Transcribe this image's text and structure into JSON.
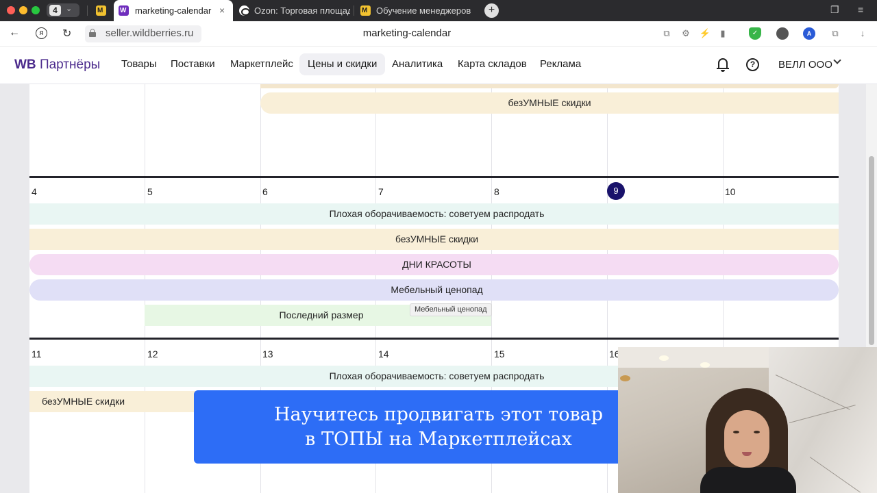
{
  "browser": {
    "tab_count": "4",
    "tabs": [
      {
        "label": ""
      },
      {
        "label": "marketing-calendar"
      },
      {
        "label": "Ozon: Торговая площадка"
      },
      {
        "label": "Обучение менеджеров"
      }
    ],
    "url": "seller.wildberries.ru",
    "page_title": "marketing-calendar",
    "new_tab_symbol": "+",
    "close_symbol": "×"
  },
  "header": {
    "brand_bold": "WB",
    "brand_rest": "Партнёры",
    "menu": [
      "Товары",
      "Поставки",
      "Маркетплейс",
      "Цены и скидки",
      "Аналитика",
      "Карта складов",
      "Реклама"
    ],
    "active_menu": "Цены и скидки",
    "help_symbol": "?",
    "account_name": "ВЕЛЛ ООО"
  },
  "calendar": {
    "prev_week": {
      "events": [
        "безУМНЫЕ скидки"
      ]
    },
    "week1": {
      "days": [
        "4",
        "5",
        "6",
        "7",
        "8",
        "9",
        "10"
      ],
      "today": "9",
      "events": [
        "Плохая оборачиваемость: советуем распродать",
        "безУМНЫЕ скидки",
        "ДНИ КРАСОТЫ",
        "Мебельный ценопад",
        "Последний размер"
      ],
      "tooltip": "Мебельный ценопад"
    },
    "week2": {
      "days": [
        "11",
        "12",
        "13",
        "14",
        "15",
        "16"
      ],
      "events": [
        "Плохая оборачиваемость: советуем распродать",
        "безУМНЫЕ скидки"
      ]
    }
  },
  "promo": {
    "line1": "Научитесь продвигать этот товар",
    "line2": "в ТОПЫ на Маркетплейсах"
  },
  "colors": {
    "brand": "#4b2a8c",
    "today_badge": "#19126b",
    "promo_blue": "#2d6df6",
    "event_mint": "#e9f6f3",
    "event_peach": "#f9efd8",
    "event_pink": "#f5dcf3",
    "event_lavender": "#e0e0f7",
    "event_green": "#e7f7e4"
  },
  "icons": [
    "back-icon",
    "yandex-icon",
    "reload-icon",
    "lock-icon",
    "bell-icon",
    "help-icon",
    "chevron-down-icon",
    "webcam-video"
  ]
}
